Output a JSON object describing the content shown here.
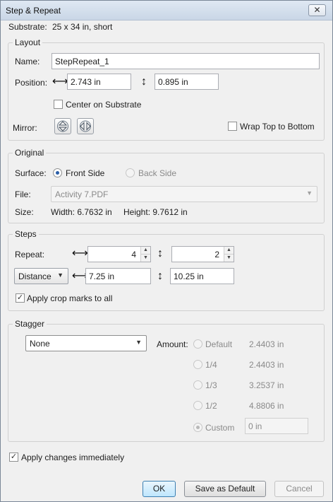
{
  "window": {
    "title": "Step & Repeat",
    "close_symbol": "✕"
  },
  "substrate": {
    "label": "Substrate:",
    "value": "25 x 34 in, short"
  },
  "layout": {
    "legend": "Layout",
    "name_label": "Name:",
    "name_value": "StepRepeat_1",
    "position_label": "Position:",
    "position_x": "2.743 in",
    "position_y": "0.895 in",
    "center_label": "Center on Substrate",
    "center_checked": false,
    "mirror_label": "Mirror:",
    "wrap_label": "Wrap Top to Bottom",
    "wrap_checked": false
  },
  "original": {
    "legend": "Original",
    "surface_label": "Surface:",
    "front_label": "Front Side",
    "back_label": "Back Side",
    "file_label": "File:",
    "file_value": "Activity 7.PDF",
    "size_label": "Size:",
    "width_text": "Width: 6.7632 in",
    "height_text": "Height: 9.7612 in"
  },
  "steps": {
    "legend": "Steps",
    "repeat_label": "Repeat:",
    "repeat_x": "4",
    "repeat_y": "2",
    "mode_value": "Distance",
    "distance_x": "7.25 in",
    "distance_y": "10.25 in",
    "crop_label": "Apply crop marks to all",
    "crop_checked": true
  },
  "stagger": {
    "legend": "Stagger",
    "mode_value": "None",
    "amount_label": "Amount:",
    "options": [
      {
        "label": "Default",
        "value": "2.4403 in"
      },
      {
        "label": "1/4",
        "value": "2.4403 in"
      },
      {
        "label": "1/3",
        "value": "3.2537 in"
      },
      {
        "label": "1/2",
        "value": "4.8806 in"
      }
    ],
    "custom_label": "Custom",
    "custom_value": "0 in"
  },
  "apply_immediately": {
    "label": "Apply changes immediately",
    "checked": true
  },
  "buttons": {
    "ok": "OK",
    "save_default": "Save as Default",
    "cancel": "Cancel"
  },
  "icons": {
    "check": "✓",
    "dropdown": "▼",
    "spin_up": "▲",
    "spin_down": "▼",
    "horizontal_arrow": "⟷",
    "vertical_arrow": "↕"
  }
}
